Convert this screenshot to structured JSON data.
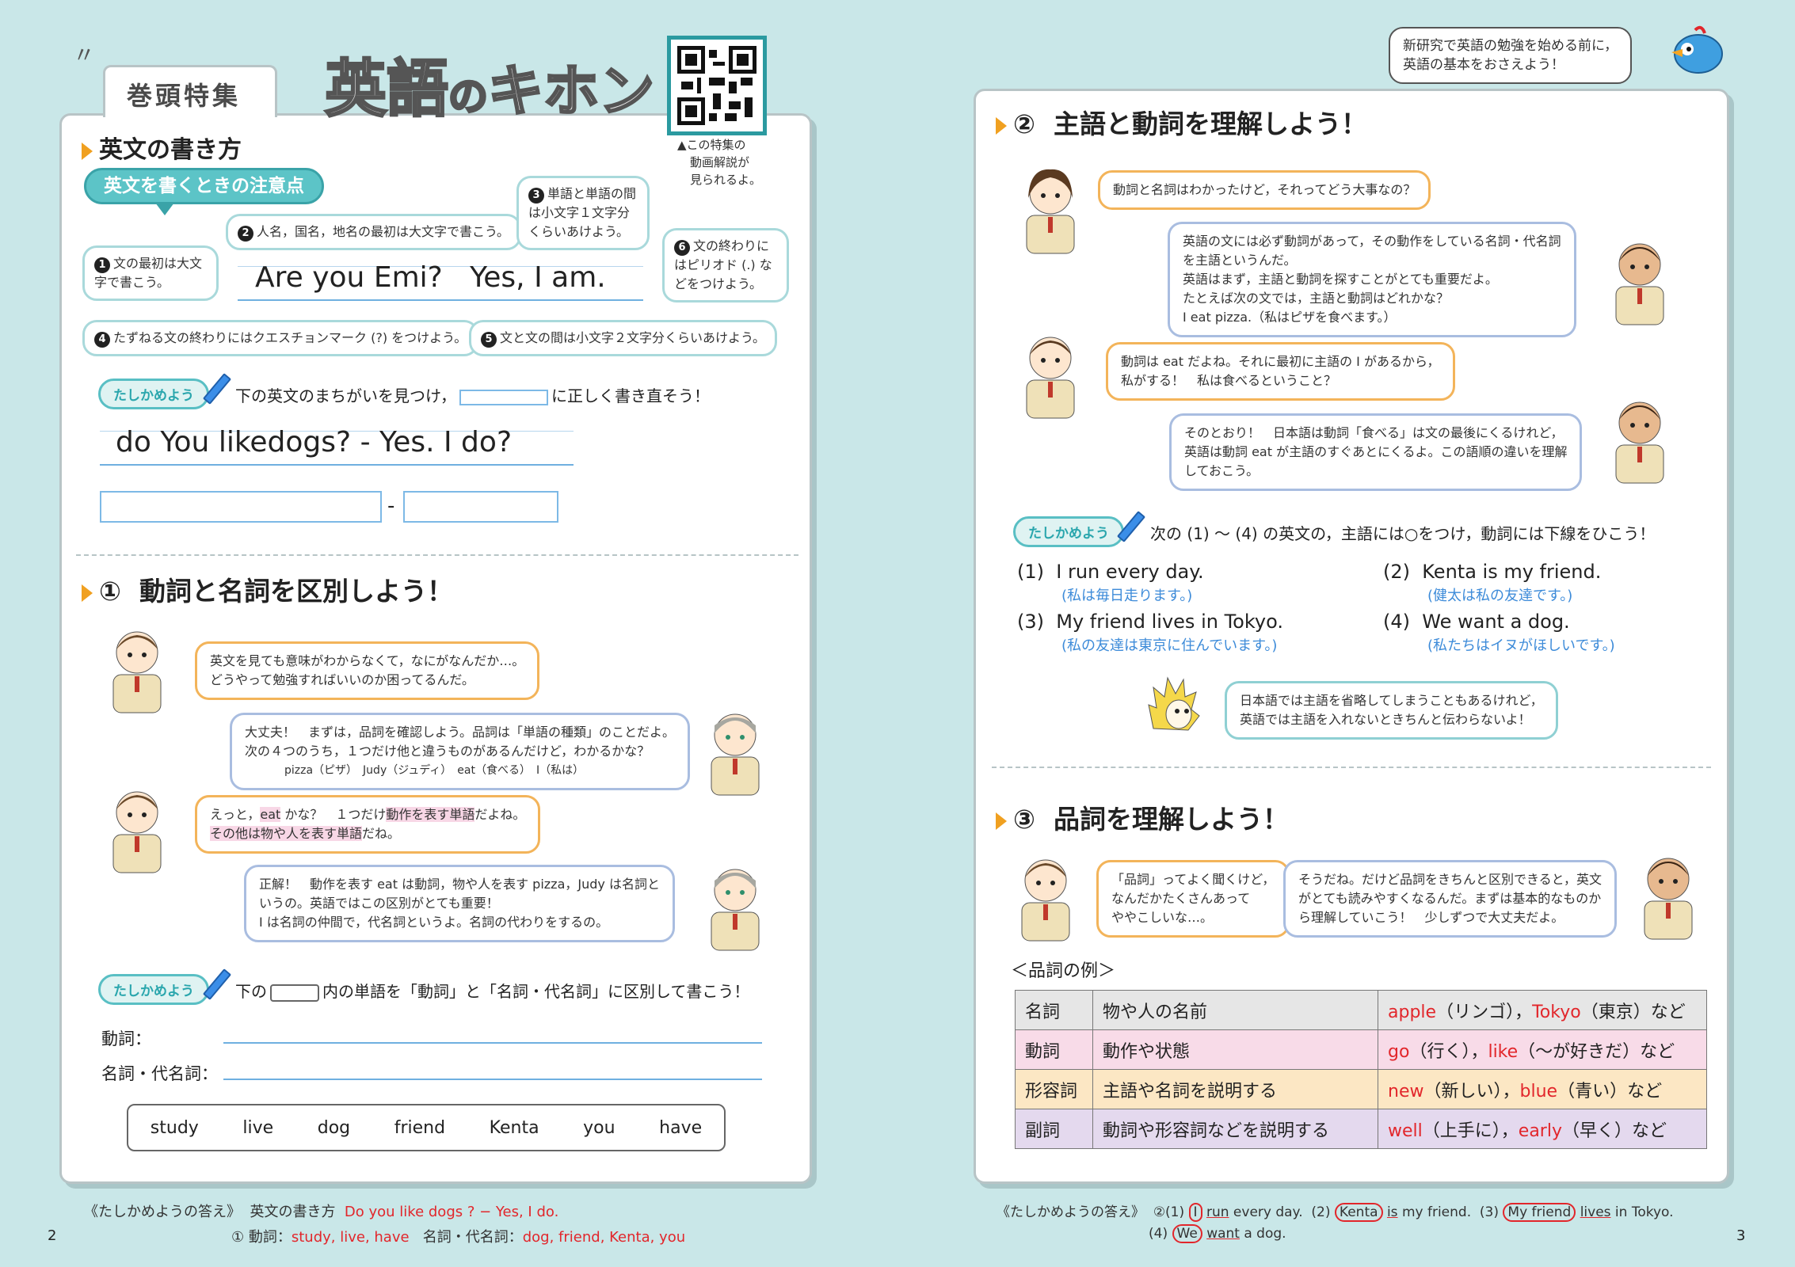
{
  "left": {
    "tag": "巻頭特集",
    "title_main": "英語",
    "title_no": "の",
    "title_rest": "キホン",
    "qr_caption": [
      "▲この特集の",
      "動画解説が",
      "見られるよ。"
    ],
    "sec_writing": "英文の書き方",
    "rules_title": "英文を書くときの注意点",
    "rule1": "文の最初は大文字で書こう。",
    "rule2": "人名，国名，地名の最初は大文字で書こう。",
    "rule3": "単語と単語の間は小文字１文字分くらいあけよう。",
    "rule4": "たずねる文の終わりにはクエスチョンマーク (?) をつけよう。",
    "rule5": "文と文の間は小文字２文字分くらいあけよう。",
    "rule6": "文の終わりにはピリオド (.) などをつけよう。",
    "sample_sentence": "Are you Emi?   Yes, I am.",
    "tashika_label": "たしかめよう",
    "q1_instruction_a": "下の英文のまちがいを見つけ，",
    "q1_instruction_b": "に正しく書き直そう！",
    "q1_sentence": "do You likedogs? - Yes. I do?",
    "q1_dash": "-",
    "sec1_num": "①",
    "sec1_title": "動詞と名詞を区別しよう！",
    "d1": "英文を見ても意味がわからなくて，なにがなんだか…。\nどうやって勉強すればいいのか困ってるんだ。",
    "d2a": "大丈夫！　まずは，品詞を確認しよう。品詞は「単語の種類」のことだよ。",
    "d2b": "次の４つのうち，１つだけ他と違うものがあるんだけど，わかるかな？",
    "d2c": "pizza（ピザ）　Judy（ジュディ）　eat（食べる）　I（私は）",
    "d3a_pre": "えっと，",
    "d3a_hl": "eat",
    "d3a_mid": " かな？　１つだけ",
    "d3a_hl2": "動作を表す単語",
    "d3a_post": "だよね。",
    "d3b_hl": "その他は物や人を表す単語",
    "d3b_post": "だね。",
    "d4a": "正解！　動作を表す eat は動詞，物や人を表す pizza，Judy は名詞と",
    "d4b": "いうの。英語ではこの区別がとても重要！",
    "d4c": "I は名詞の仲間で，代名詞というよ。名詞の代わりをするの。",
    "q2_pre": "下の",
    "q2_post": "内の単語を「動詞」と「名詞・代名詞」に区別して書こう！",
    "verb_label": "動詞：",
    "noun_label": "名詞・代名詞：",
    "words": [
      "study",
      "live",
      "dog",
      "friend",
      "Kenta",
      "you",
      "have"
    ],
    "answers_heading": "《たしかめようの答え》",
    "answers_item1": "英文の書き方",
    "answers_1": "Do you like dogs ? − Yes, I do.",
    "answers_2_num": "① 動詞：",
    "answers_2_verbs": "study,  live,  have",
    "answers_2_nlabel": "名詞・代名詞：",
    "answers_2_nouns": "dog,  friend,  Kenta,  you",
    "page_num": "2"
  },
  "right": {
    "intro": "新研究で英語の勉強を始める前に，\n英語の基本をおさえよう！",
    "sec2_num": "②",
    "sec2_title": "主語と動詞を理解しよう！",
    "e1": "動詞と名詞はわかったけど，それってどう大事なの？",
    "e2a": "英語の文には必ず動詞があって，その動作をしている名詞・代名詞",
    "e2b": "を主語というんだ。",
    "e2c": "英語はまず，主語と動詞を探すことがとても重要だよ。",
    "e2d": "たとえば次の文では，主語と動詞はどれかな？",
    "e2e": "I eat pizza.（私はピザを食べます。）",
    "e3a": "動詞は eat だよね。それに最初に主語の I があるから，",
    "e3b": "私がする！　私は食べるということ？",
    "e4a": "そのとおり！　日本語は動詞「食べる」は文の最後にくるけれど，",
    "e4b": "英語は動詞 eat が主語のすぐあとにくるよ。この語順の違いを理解",
    "e4c": "しておこう。",
    "q3": "次の (1) 〜 (4) の英文の，主語には○をつけ，動詞には下線をひこう！",
    "ex": [
      {
        "n": "(1)",
        "en": "I run every day.",
        "ja": "(私は毎日走ります。)"
      },
      {
        "n": "(2)",
        "en": "Kenta is my friend.",
        "ja": "(健太は私の友達です。)"
      },
      {
        "n": "(3)",
        "en": "My friend lives in Tokyo.",
        "ja": "(私の友達は東京に住んでいます。)"
      },
      {
        "n": "(4)",
        "en": "We want a dog.",
        "ja": "(私たちはイヌがほしいです。)"
      }
    ],
    "hedgehog": "日本語では主語を省略してしまうこともあるけれど，\n英語では主語を入れないときちんと伝わらないよ！",
    "sec3_num": "③",
    "sec3_title": "品詞を理解しよう！",
    "f1": "「品詞」ってよく聞くけど，\nなんだかたくさんあって\nややこしいな…。",
    "f2": "そうだね。だけど品詞をきちんと区別できると，英文\nがとても読みやすくなるんだ。まずは基本的なものか\nら理解していこう！　少しずつで大丈夫だよ。",
    "table_caption": "＜品詞の例＞",
    "table": [
      {
        "pos": "名詞",
        "desc": "物や人の名前",
        "ex1": "apple",
        "ex1j": "（リンゴ），",
        "ex2": "Tokyo",
        "ex2j": "（東京）など",
        "bg": "#e6e6e6"
      },
      {
        "pos": "動詞",
        "desc": "動作や状態",
        "ex1": "go",
        "ex1j": "（行く），",
        "ex2": "like",
        "ex2j": "（〜が好きだ）など",
        "bg": "#f8dbe8"
      },
      {
        "pos": "形容詞",
        "desc": "主語や名詞を説明する",
        "ex1": "new",
        "ex1j": "（新しい），",
        "ex2": "blue",
        "ex2j": "（青い）など",
        "bg": "#fce7c4"
      },
      {
        "pos": "副詞",
        "desc": "動詞や形容詞などを説明する",
        "ex1": "well",
        "ex1j": "（上手に），",
        "ex2": "early",
        "ex2j": "（早く）など",
        "bg": "#e4d9ee"
      }
    ],
    "answers_heading": "《たしかめようの答え》",
    "ans_2_1": "②(1)",
    "ans_s1": "I",
    "ans_v1": "run",
    "ans_r1": " every day.",
    "ans_n2": "(2)",
    "ans_s2": "Kenta",
    "ans_v2": "is",
    "ans_r2": " my friend.",
    "ans_n3": "(3)",
    "ans_s3": "My friend",
    "ans_v3": "lives",
    "ans_r3": " in Tokyo.",
    "ans_n4": "(4)",
    "ans_s4": "We",
    "ans_v4": "want",
    "ans_r4": " a dog.",
    "page_num": "3"
  },
  "colors": {
    "accent": "#f0a020",
    "teal": "#59bfc4",
    "answer_red": "#e2262b",
    "jp_blue": "#3d8bd9"
  }
}
